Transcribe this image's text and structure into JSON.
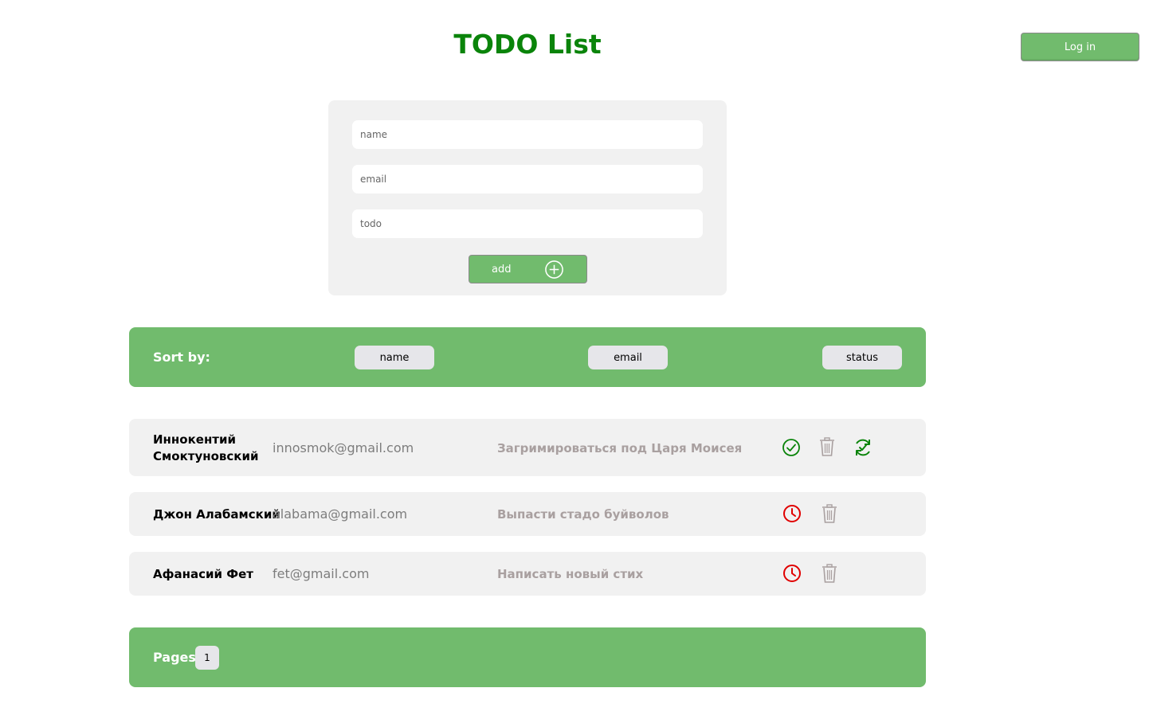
{
  "header": {
    "title": "TODO List",
    "login_label": "Log in"
  },
  "form": {
    "name_placeholder": "name",
    "email_placeholder": "email",
    "todo_placeholder": "todo",
    "add_label": "add"
  },
  "sort": {
    "label": "Sort by:",
    "buttons": [
      "name",
      "email",
      "status"
    ]
  },
  "todos": [
    {
      "name": "Иннокентий Смоктуновский",
      "email": "innosmok@gmail.com",
      "text": "Загримироваться под Царя Моисея",
      "status": "done",
      "icons": [
        "check-circle-icon",
        "trash-icon",
        "refresh-check-icon"
      ]
    },
    {
      "name": "Джон Алабамский",
      "email": "alabama@gmail.com",
      "text": "Выпасти стадо буйволов",
      "status": "pending",
      "icons": [
        "clock-icon",
        "trash-icon"
      ]
    },
    {
      "name": "Афанасий Фет",
      "email": "fet@gmail.com",
      "text": "Написать новый стих",
      "status": "pending",
      "icons": [
        "clock-icon",
        "trash-icon"
      ]
    }
  ],
  "pagination": {
    "label": "Pages:",
    "pages": [
      "1"
    ]
  },
  "colors": {
    "accent_green": "#71bb6d",
    "title_green": "#0a840a",
    "done_green": "#0a840a",
    "pending_red": "#e00000",
    "trash_gray": "#a9a0a0"
  }
}
